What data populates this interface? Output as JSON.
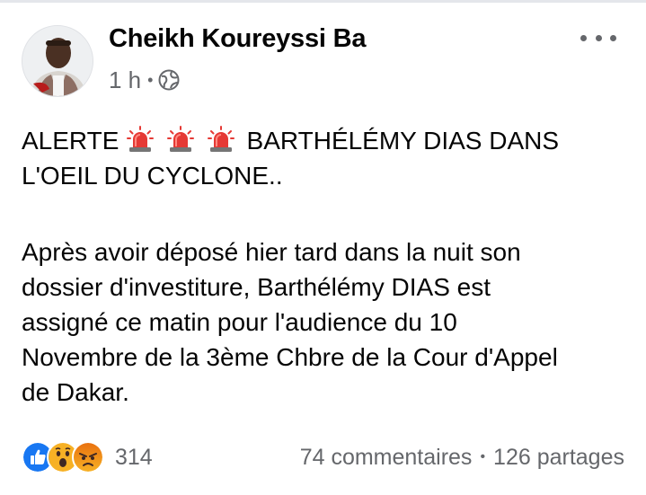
{
  "post": {
    "author": "Cheikh Koureyssi Ba",
    "time": "1 h",
    "separator": "•",
    "privacy_icon": "globe-icon",
    "more_icon": "more-options-icon",
    "headline_prefix": "ALERTE",
    "headline_emojis": [
      "police-light-icon",
      "police-light-icon",
      "police-light-icon"
    ],
    "headline_rest": "BARTHÉLÉMY DIAS DANS",
    "headline_line2": "L'OEIL DU CYCLONE..",
    "body_lines": [
      "Après avoir déposé hier tard dans la nuit son",
      "dossier d'investiture, Barthélémy DIAS est",
      "assigné ce matin pour l'audience du 10",
      "Novembre de la 3ème Chbre de la Cour d'Appel",
      "de Dakar."
    ]
  },
  "engagement": {
    "reaction_icons": [
      "like-icon",
      "wow-icon",
      "angry-icon"
    ],
    "reactions_count": "314",
    "comments": "74 commentaires",
    "separator": "•",
    "shares": "126 partages"
  },
  "colors": {
    "like_blue": "#1877f2",
    "reaction_yellow": "#f7b125",
    "angry_orange": "#e9710f",
    "secondary_text": "#65676b"
  }
}
